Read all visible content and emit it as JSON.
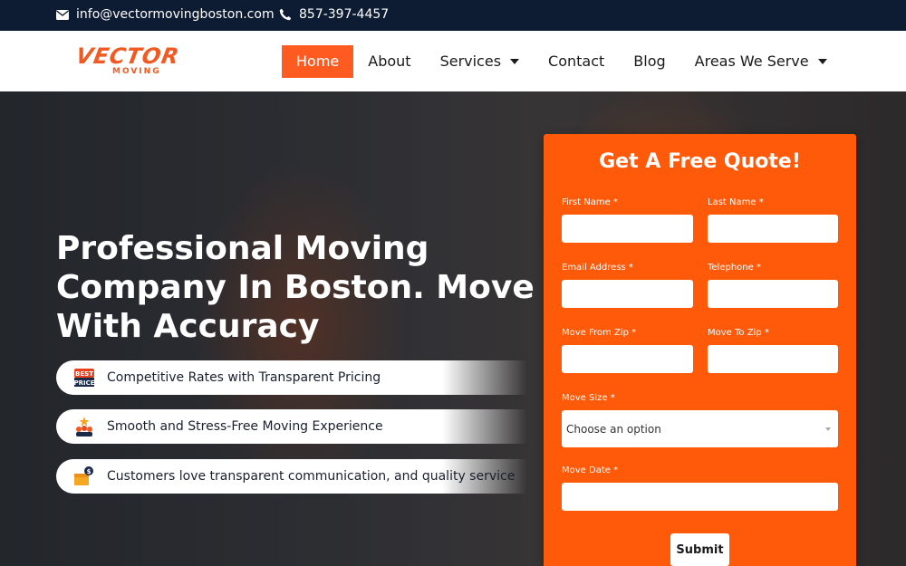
{
  "topbar": {
    "email": "info@vectormovingboston.com",
    "phone": "857-397-4457"
  },
  "logo": {
    "word": "VECTOR",
    "sub": "MOVING",
    "color": "#f15a22"
  },
  "nav": {
    "items": [
      {
        "label": "Home",
        "active": true
      },
      {
        "label": "About"
      },
      {
        "label": "Services",
        "dropdown": true
      },
      {
        "label": "Contact"
      },
      {
        "label": "Blog"
      },
      {
        "label": "Areas We Serve",
        "dropdown": true
      }
    ]
  },
  "hero": {
    "title": "Professional Moving Company In Boston. Move With Accuracy",
    "features": [
      {
        "icon": "best-price-icon",
        "text": "Competitive Rates with Transparent Pricing"
      },
      {
        "icon": "team-icon",
        "text": "Smooth and Stress-Free Moving Experience"
      },
      {
        "icon": "money-box-icon",
        "text": "Customers love transparent communication, and quality service"
      }
    ]
  },
  "form": {
    "title": "Get A Free Quote!",
    "first_name_label": "First Name *",
    "last_name_label": "Last Name *",
    "email_label": "Email Address *",
    "telephone_label": "Telephone *",
    "from_zip_label": "Move From Zip *",
    "to_zip_label": "Move To Zip *",
    "size_label": "Move Size *",
    "size_value": "Choose an option",
    "date_label": "Move Date *",
    "submit_label": "Submit"
  },
  "colors": {
    "accent": "#ff5a0a",
    "topbar": "#0d1b33"
  }
}
